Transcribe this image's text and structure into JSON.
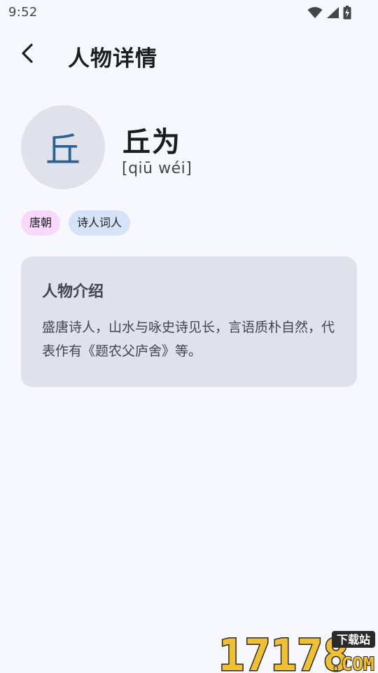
{
  "status_bar": {
    "time": "9:52"
  },
  "app_bar": {
    "title": "人物详情"
  },
  "person": {
    "avatar_char": "丘",
    "name": "丘为",
    "pinyin": "[qiū wéi]",
    "tags": [
      "唐朝",
      "诗人词人"
    ]
  },
  "intro": {
    "title": "人物介绍",
    "text": "盛唐诗人，山水与咏史诗见长，言语质朴自然，代表作有《题农父庐舍》等。"
  },
  "watermark": {
    "text": "17178",
    "sub": "下载站",
    "suffix": ".COM"
  },
  "colors": {
    "background": "#f7f8fd",
    "avatar_bg": "#dfe2eb",
    "avatar_char": "#2c6396",
    "tag_dynasty_bg": "#f8d8fb",
    "tag_role_bg": "#d4e3f7",
    "card_bg": "#dfe2eb"
  }
}
